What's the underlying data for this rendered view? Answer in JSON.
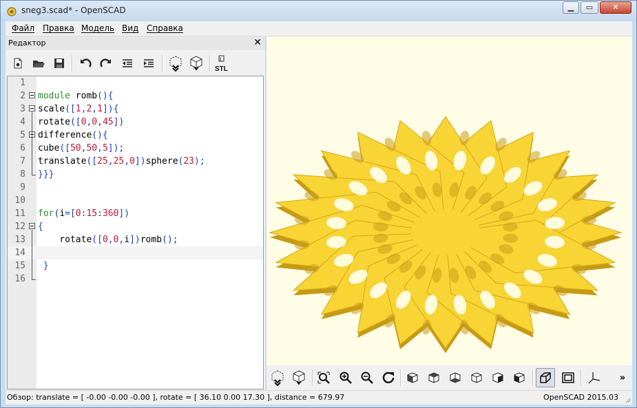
{
  "window": {
    "title": "sneg3.scad* - OpenSCAD"
  },
  "menu": [
    {
      "label": "Файл"
    },
    {
      "label": "Правка"
    },
    {
      "label": "Модель"
    },
    {
      "label": "Вид"
    },
    {
      "label": "Справка"
    }
  ],
  "editor": {
    "title": "Редактор",
    "toolbar": [
      "new-file-icon",
      "open-file-icon",
      "save-icon",
      "undo-icon",
      "redo-icon",
      "unindent-icon",
      "indent-icon",
      "preview-icon",
      "render-icon",
      "export-stl-icon"
    ],
    "stl_label": "STL",
    "lines": [
      {
        "n": "1",
        "code": []
      },
      {
        "n": "2",
        "code": [
          [
            "kw",
            "module"
          ],
          [
            "id",
            " romb"
          ],
          [
            "pn",
            "(){"
          ]
        ]
      },
      {
        "n": "3",
        "code": [
          [
            "id",
            "scale"
          ],
          [
            "pn",
            "(["
          ],
          [
            "num",
            "1"
          ],
          [
            "pn",
            ","
          ],
          [
            "num",
            "2"
          ],
          [
            "pn",
            ","
          ],
          [
            "num",
            "1"
          ],
          [
            "pn",
            "]){"
          ]
        ]
      },
      {
        "n": "4",
        "code": [
          [
            "id",
            "rotate"
          ],
          [
            "pn",
            "(["
          ],
          [
            "num",
            "0"
          ],
          [
            "pn",
            ","
          ],
          [
            "num",
            "0"
          ],
          [
            "pn",
            ","
          ],
          [
            "num",
            "45"
          ],
          [
            "pn",
            "])"
          ]
        ]
      },
      {
        "n": "5",
        "code": [
          [
            "id",
            "difference"
          ],
          [
            "pn",
            "(){"
          ]
        ]
      },
      {
        "n": "6",
        "code": [
          [
            "id",
            "cube"
          ],
          [
            "pn",
            "(["
          ],
          [
            "num",
            "50"
          ],
          [
            "pn",
            ","
          ],
          [
            "num",
            "50"
          ],
          [
            "pn",
            ","
          ],
          [
            "num",
            "5"
          ],
          [
            "pn",
            "]);"
          ]
        ]
      },
      {
        "n": "7",
        "code": [
          [
            "id",
            "translate"
          ],
          [
            "pn",
            "(["
          ],
          [
            "num",
            "25"
          ],
          [
            "pn",
            ","
          ],
          [
            "num",
            "25"
          ],
          [
            "pn",
            ","
          ],
          [
            "num",
            "0"
          ],
          [
            "pn",
            "])"
          ],
          [
            "id",
            "sphere"
          ],
          [
            "pn",
            "("
          ],
          [
            "num",
            "23"
          ],
          [
            "pn",
            ");"
          ]
        ]
      },
      {
        "n": "8",
        "code": [
          [
            "pn",
            "}}}"
          ]
        ]
      },
      {
        "n": "9",
        "code": []
      },
      {
        "n": "10",
        "code": []
      },
      {
        "n": "11",
        "code": [
          [
            "kw",
            "for"
          ],
          [
            "pn",
            "("
          ],
          [
            "id",
            "i"
          ],
          [
            "pn",
            "=["
          ],
          [
            "num",
            "0"
          ],
          [
            "pn",
            ":"
          ],
          [
            "num",
            "15"
          ],
          [
            "pn",
            ":"
          ],
          [
            "num",
            "360"
          ],
          [
            "pn",
            "])"
          ]
        ]
      },
      {
        "n": "12",
        "code": [
          [
            "pn",
            "{"
          ]
        ]
      },
      {
        "n": "13",
        "code": [
          [
            "id",
            "    rotate"
          ],
          [
            "pn",
            "(["
          ],
          [
            "num",
            "0"
          ],
          [
            "pn",
            ","
          ],
          [
            "num",
            "0"
          ],
          [
            "pn",
            ","
          ],
          [
            "id",
            "i"
          ],
          [
            "pn",
            "])"
          ],
          [
            "id",
            "romb"
          ],
          [
            "pn",
            "();"
          ]
        ]
      },
      {
        "n": "14",
        "code": []
      },
      {
        "n": "15",
        "code": [
          [
            "pn",
            " }"
          ]
        ]
      },
      {
        "n": "16",
        "code": []
      }
    ]
  },
  "viewer": {
    "model_color": "#f8d434",
    "shadow_color": "#c79a13",
    "background": "#fffde6",
    "toolbar": [
      "preview-icon",
      "render-icon",
      "view-all-icon",
      "zoom-in-icon",
      "zoom-out-icon",
      "reset-view-icon",
      "view-right-icon",
      "view-top-icon",
      "view-bottom-icon",
      "view-left-icon",
      "view-front-icon",
      "view-back-icon",
      "perspective-icon",
      "orthogonal-icon",
      "show-axes-icon",
      "more-icon"
    ]
  },
  "status": {
    "left": "Обзор: translate = [ -0.00 -0.00 -0.00 ], rotate = [ 36.10 0.00 17.30 ], distance = 679.97",
    "right": "OpenSCAD 2015.03"
  }
}
